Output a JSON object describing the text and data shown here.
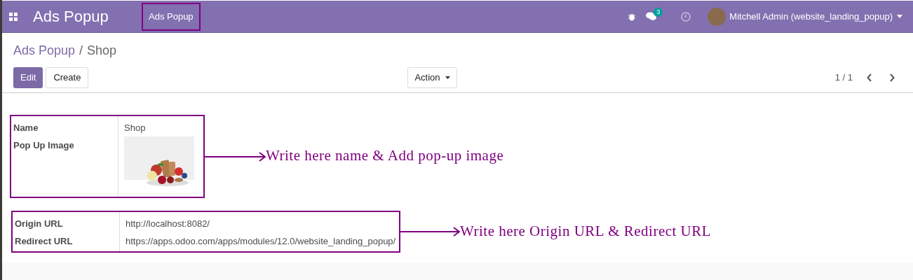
{
  "navbar": {
    "app_title": "Ads Popup",
    "menu_item": {
      "label": "Ads Popup",
      "annotated": true
    },
    "chat_badge": "3",
    "user": "Mitchell Admin (website_landing_popup)"
  },
  "breadcrumb": {
    "parent": "Ads Popup",
    "separator": "/",
    "current": "Shop"
  },
  "buttons": [
    {
      "label": "Edit",
      "kind": "primary"
    },
    {
      "label": "Create",
      "kind": "secondary"
    }
  ],
  "action": "Action",
  "pager": "1 / 1",
  "groups": [
    {
      "fields": [
        {
          "label": "Name",
          "kind": "text",
          "value": "Shop"
        },
        {
          "label": "Pop Up Image"
        }
      ],
      "note": "Write here name & Add pop-up image"
    },
    {
      "fields": [
        {
          "label": "Origin URL",
          "kind": "text",
          "value": "http://localhost:8082/"
        },
        {
          "label": "Redirect URL",
          "kind": "text",
          "value": "https://apps.odoo.com/apps/modules/12.0/website_landing_popup/"
        }
      ],
      "note": "Write here Origin URL & Redirect URL"
    }
  ]
}
